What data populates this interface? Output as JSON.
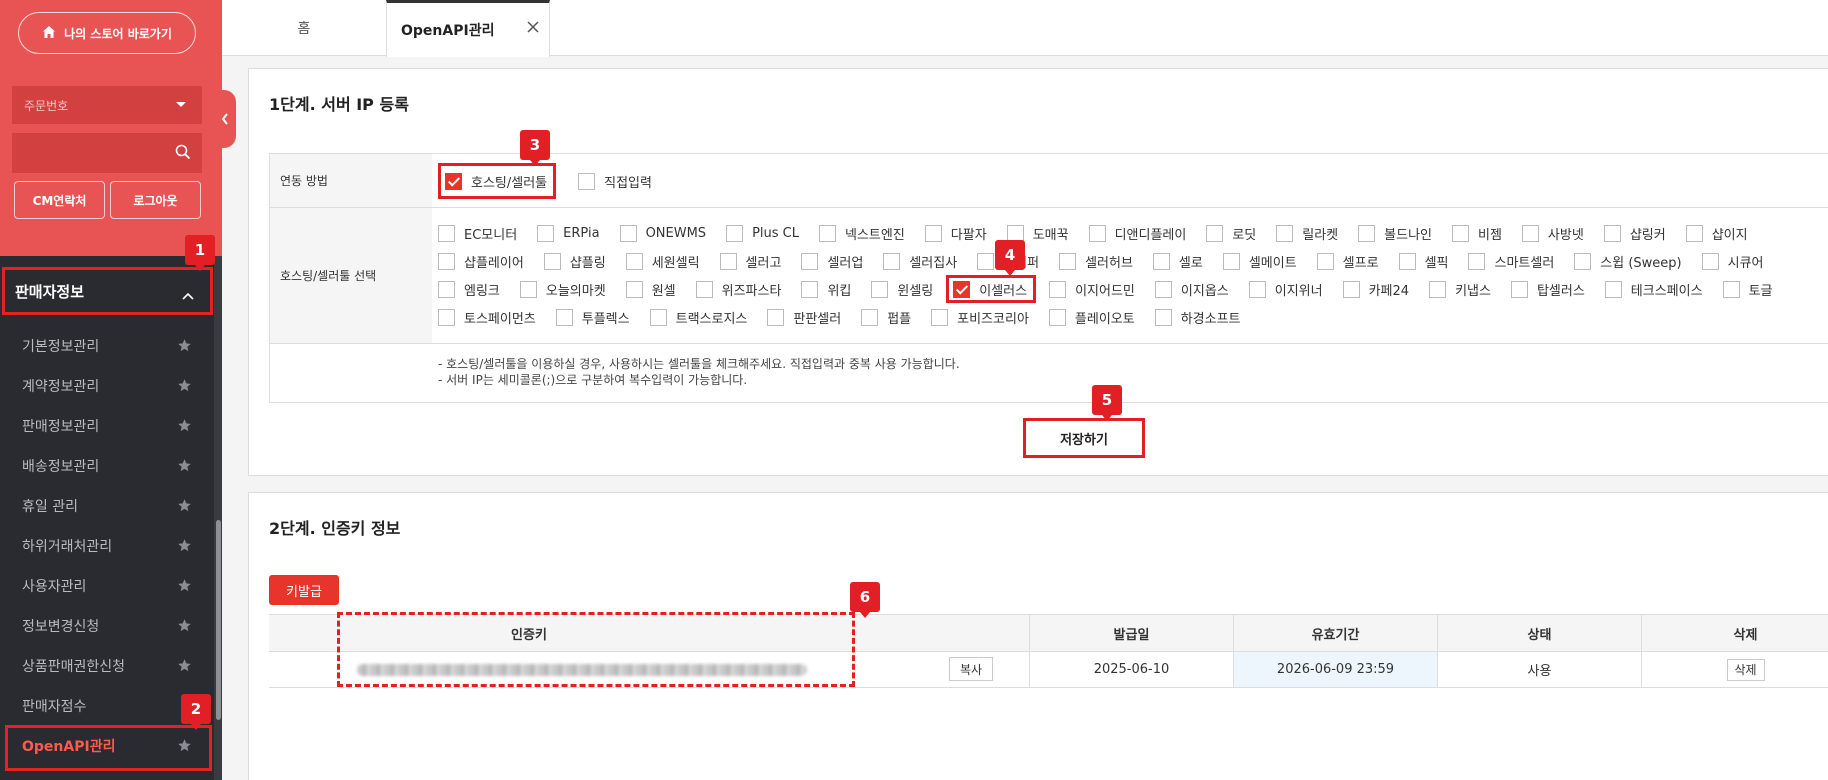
{
  "sidebar": {
    "store_button": "나의 스토어 바로가기",
    "order_select": "주문번호",
    "search_placeholder": "",
    "cm_button": "CM연락처",
    "logout_button": "로그아웃",
    "section_title": "판매자정보",
    "menu": [
      {
        "label": "기본정보관리",
        "star": true
      },
      {
        "label": "계약정보관리",
        "star": true
      },
      {
        "label": "판매정보관리",
        "star": true
      },
      {
        "label": "배송정보관리",
        "star": true
      },
      {
        "label": "휴일 관리",
        "star": true
      },
      {
        "label": "하위거래처관리",
        "star": true
      },
      {
        "label": "사용자관리",
        "star": true
      },
      {
        "label": "정보변경신청",
        "star": true
      },
      {
        "label": "상품판매권한신청",
        "star": true
      },
      {
        "label": "판매자점수",
        "star": false
      },
      {
        "label": "OpenAPI관리",
        "star": true,
        "active": true
      }
    ]
  },
  "tabs": {
    "home": "홈",
    "openapi": "OpenAPI관리"
  },
  "step1": {
    "title": "1단계. 서버 IP 등록",
    "method_label": "연동 방법",
    "methods": [
      {
        "label": "호스팅/셀러툴",
        "checked": true
      },
      {
        "label": "직접입력",
        "checked": false
      }
    ],
    "tools_label": "호스팅/셀러툴 선택",
    "tools": [
      [
        "EC모니터",
        "ERPia",
        "ONEWMS",
        "Plus CL",
        "넥스트엔진",
        "다팔자",
        "도매꾹",
        "디앤디플레이",
        "로딧",
        "릴라켓",
        "볼드나인",
        "비젬",
        "사방넷",
        "샵링커",
        "샵이지"
      ],
      [
        "샵플레이어",
        "샵플링",
        "세원셀릭",
        "셀러고",
        "셀러업",
        "셀러집사",
        "셀러퍼",
        "셀러허브",
        "셀로",
        "셀메이트",
        "셀프로",
        "셀픽",
        "스마트셀러",
        "스윕 (Sweep)",
        "시큐어"
      ],
      [
        "엠링크",
        "오늘의마켓",
        "원셀",
        "위즈파스타",
        "위킵",
        "윈셀링",
        "이셀러스",
        "이지어드민",
        "이지옵스",
        "이지위너",
        "카페24",
        "키냅스",
        "탑셀러스",
        "테크스페이스",
        "토글"
      ],
      [
        "토스페이먼츠",
        "투플렉스",
        "트랙스로지스",
        "판판셀러",
        "펍플",
        "포비즈코리아",
        "플레이오토",
        "하경소프트"
      ]
    ],
    "checked_tool": "이셀러스",
    "notes": [
      "- 호스팅/셀러툴을 이용하실 경우, 사용하시는 셀러툴을 체크해주세요. 직접입력과 중복 사용 가능합니다.",
      "- 서버 IP는 세미콜론(;)으로 구분하여 복수입력이 가능합니다."
    ],
    "save_button": "저장하기"
  },
  "step2": {
    "title": "2단계. 인증키 정보",
    "keygen_button": "키발급",
    "columns": [
      "인증키",
      "발급일",
      "유효기간",
      "상태",
      "삭제"
    ],
    "row": {
      "copy_button": "복사",
      "issued": "2025-06-10",
      "valid_until": "2026-06-09 23:59",
      "status": "사용",
      "delete_button": "삭제"
    }
  },
  "badges": [
    "1",
    "2",
    "3",
    "4",
    "5",
    "6"
  ],
  "colors": {
    "accent": "#e85454",
    "highlight": "#e31f26",
    "sidebar_bg": "#2a2b30",
    "active_menu": "#ff5a4e"
  }
}
